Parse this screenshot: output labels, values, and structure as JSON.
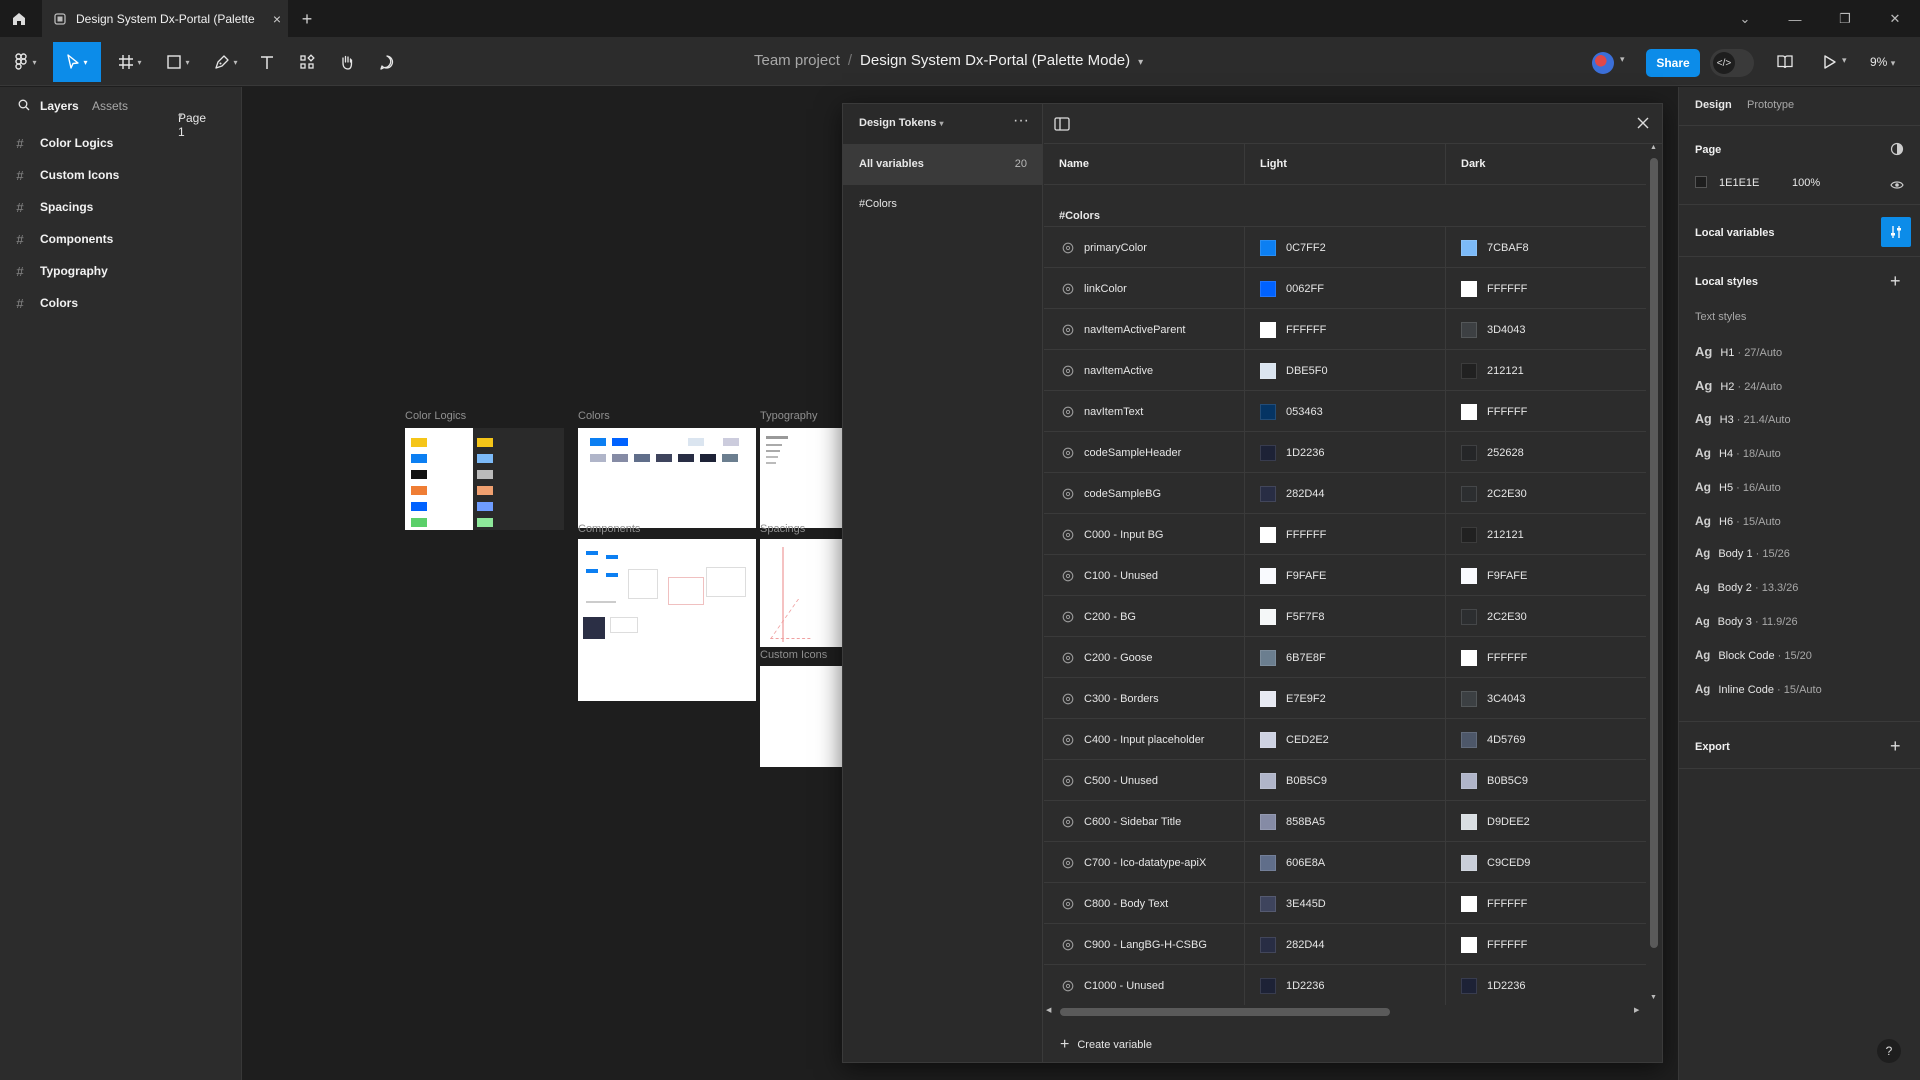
{
  "titlebar": {
    "tab_title": "Design System Dx-Portal (Palette",
    "tab_close": "×",
    "new_tab": "+",
    "controls": [
      "⌄",
      "—",
      "❐",
      "✕"
    ]
  },
  "toolbar": {
    "breadcrumb_team": "Team project",
    "breadcrumb_sep": "/",
    "file_name": "Design System Dx-Portal (Palette Mode)",
    "share_label": "Share",
    "zoom": "9%"
  },
  "left_panel": {
    "tab_layers": "Layers",
    "tab_assets": "Assets",
    "page_selector": "Page 1",
    "layers": [
      "Color Logics",
      "Custom Icons",
      "Spacings",
      "Components",
      "Typography",
      "Colors"
    ]
  },
  "canvas": {
    "frame_labels": {
      "color_logics": "Color Logics",
      "colors": "Colors",
      "typography": "Typography",
      "components": "Components",
      "spacings": "Spacings",
      "custom_icons": "Custom Icons"
    }
  },
  "variables_modal": {
    "collection_title": "Design Tokens",
    "all_variables_label": "All variables",
    "all_variables_count": "20",
    "group_nav": "#Colors",
    "columns": {
      "name": "Name",
      "light": "Light",
      "dark": "Dark"
    },
    "group_header": "#Colors",
    "create_label": "Create variable",
    "variables": [
      {
        "name": "primaryColor",
        "light": "0C7FF2",
        "dark": "7CBAF8"
      },
      {
        "name": "linkColor",
        "light": "0062FF",
        "dark": "FFFFFF"
      },
      {
        "name": "navItemActiveParent",
        "light": "FFFFFF",
        "dark": "3D4043"
      },
      {
        "name": "navItemActive",
        "light": "DBE5F0",
        "dark": "212121"
      },
      {
        "name": "navItemText",
        "light": "053463",
        "dark": "FFFFFF"
      },
      {
        "name": "codeSampleHeader",
        "light": "1D2236",
        "dark": "252628"
      },
      {
        "name": "codeSampleBG",
        "light": "282D44",
        "dark": "2C2E30"
      },
      {
        "name": "C000 - Input BG",
        "light": "FFFFFF",
        "dark": "212121"
      },
      {
        "name": "C100 - Unused",
        "light": "F9FAFE",
        "dark": "F9FAFE"
      },
      {
        "name": "C200 - BG",
        "light": "F5F7F8",
        "dark": "2C2E30"
      },
      {
        "name": "C200 - Goose",
        "light": "6B7E8F",
        "dark": "FFFFFF"
      },
      {
        "name": "C300 - Borders",
        "light": "E7E9F2",
        "dark": "3C4043"
      },
      {
        "name": "C400 - Input placeholder",
        "light": "CED2E2",
        "dark": "4D5769"
      },
      {
        "name": "C500 - Unused",
        "light": "B0B5C9",
        "dark": "B0B5C9"
      },
      {
        "name": "C600 - Sidebar Title",
        "light": "858BA5",
        "dark": "D9DEE2"
      },
      {
        "name": "C700 - Ico-datatype-apiX",
        "light": "606E8A",
        "dark": "C9CED9"
      },
      {
        "name": "C800 - Body Text",
        "light": "3E445D",
        "dark": "FFFFFF"
      },
      {
        "name": "C900 - LangBG-H-CSBG",
        "light": "282D44",
        "dark": "FFFFFF"
      },
      {
        "name": "C1000 - Unused",
        "light": "1D2236",
        "dark": "1D2236"
      }
    ]
  },
  "right_panel": {
    "tab_design": "Design",
    "tab_prototype": "Prototype",
    "page_title": "Page",
    "page_color": "1E1E1E",
    "page_opacity": "100%",
    "local_variables": "Local variables",
    "local_styles": "Local styles",
    "text_styles_title": "Text styles",
    "text_styles": [
      {
        "ag": "Ag",
        "name": "H1",
        "meta": "27/Auto"
      },
      {
        "ag": "Ag",
        "name": "H2",
        "meta": "24/Auto"
      },
      {
        "ag": "Ag",
        "name": "H3",
        "meta": "21.4/Auto"
      },
      {
        "ag": "Ag",
        "name": "H4",
        "meta": "18/Auto"
      },
      {
        "ag": "Ag",
        "name": "H5",
        "meta": "16/Auto"
      },
      {
        "ag": "Ag",
        "name": "H6",
        "meta": "15/Auto"
      },
      {
        "ag": "Ag",
        "name": "Body 1",
        "meta": "15/26"
      },
      {
        "ag": "Ag",
        "name": "Body 2",
        "meta": "13.3/26"
      },
      {
        "ag": "Ag",
        "name": "Body 3",
        "meta": "11.9/26"
      },
      {
        "ag": "Ag",
        "name": "Block Code",
        "meta": "15/20"
      },
      {
        "ag": "Ag",
        "name": "Inline Code",
        "meta": "15/Auto"
      }
    ],
    "export_title": "Export",
    "help": "?"
  },
  "colors": {
    "accent": "#0C8CE9",
    "canvas": "#1E1E1E",
    "panel": "#2C2C2C"
  }
}
